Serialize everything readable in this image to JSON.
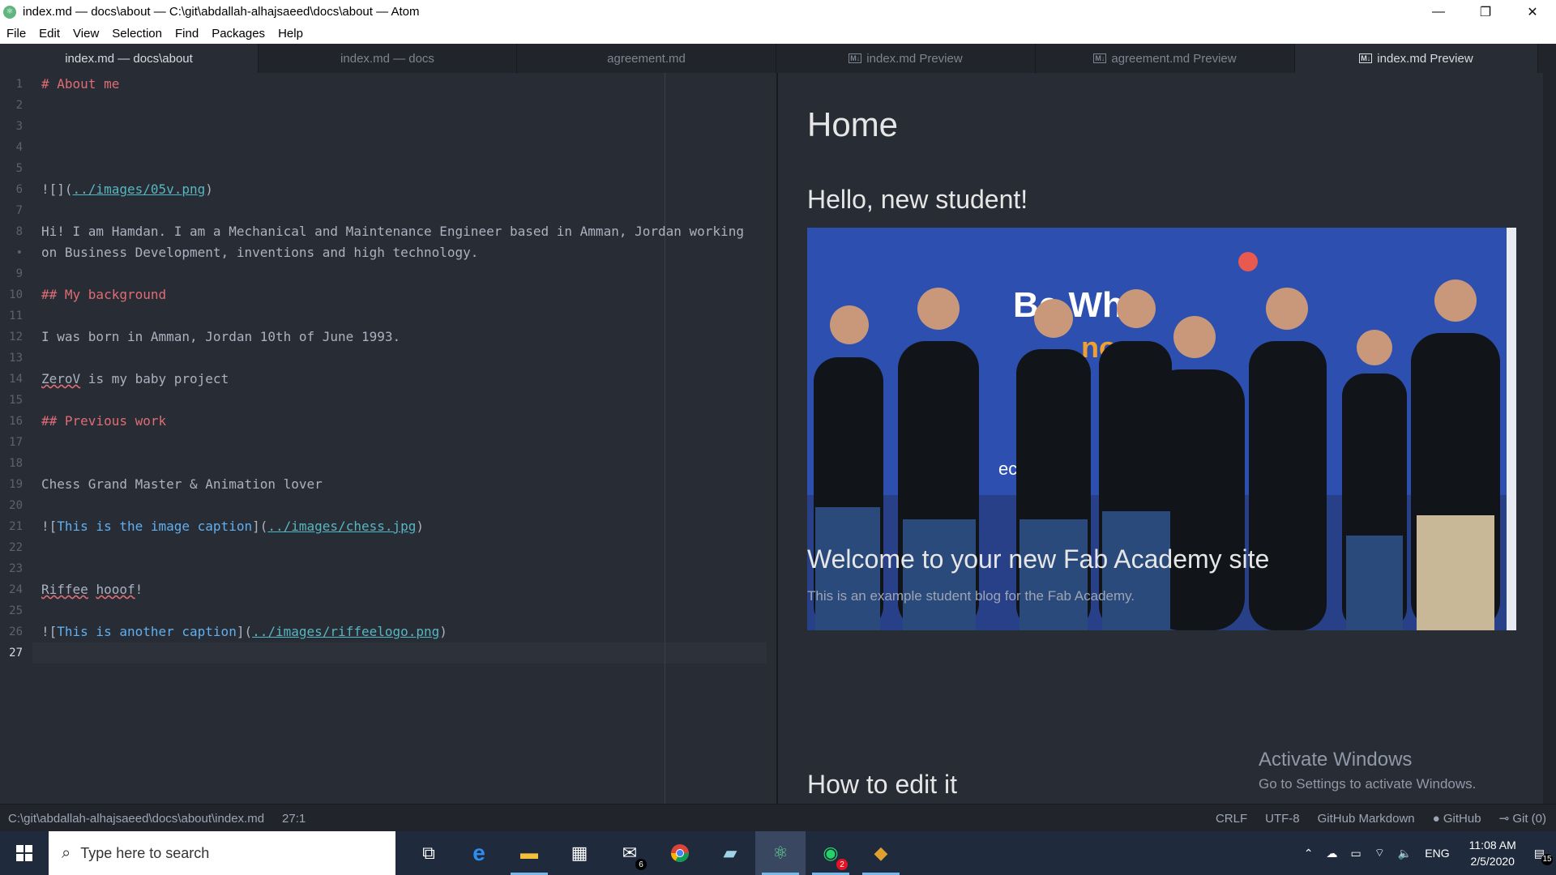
{
  "window": {
    "title": "index.md — docs\\about — C:\\git\\abdallah-alhajsaeed\\docs\\about — Atom",
    "minimize": "—",
    "maximize": "❐",
    "close": "✕"
  },
  "menu": [
    "File",
    "Edit",
    "View",
    "Selection",
    "Find",
    "Packages",
    "Help"
  ],
  "tabs": [
    {
      "label": "index.md — docs\\about",
      "md_icon": ""
    },
    {
      "label": "index.md — docs",
      "md_icon": ""
    },
    {
      "label": "agreement.md",
      "md_icon": ""
    },
    {
      "label": "index.md Preview",
      "md_icon": "M↓"
    },
    {
      "label": "agreement.md Preview",
      "md_icon": "M↓"
    },
    {
      "label": "index.md Preview",
      "md_icon": "M↓"
    }
  ],
  "editor": {
    "line_numbers": [
      "1",
      "2",
      "3",
      "4",
      "5",
      "6",
      "7",
      "8",
      "•",
      "9",
      "10",
      "11",
      "12",
      "13",
      "14",
      "15",
      "16",
      "17",
      "18",
      "19",
      "20",
      "21",
      "22",
      "23",
      "24",
      "25",
      "26",
      "27"
    ],
    "lines": {
      "l1": "# About me",
      "l6a": "![](",
      "l6b": "../images/05v.png",
      "l6c": ")",
      "l8": "Hi! I am Hamdan. I am a Mechanical and Maintenance Engineer based in Amman, Jordan working",
      "l8b": "on Business Development, inventions and high technology.",
      "l10": "## My background",
      "l12": "I was born in Amman, Jordan 10th of June 1993.",
      "l14a": "ZeroV",
      "l14b": " is my baby project",
      "l16": "## Previous work",
      "l19": "Chess Grand Master & Animation lover",
      "l21a": "![",
      "l21b": "This is the image caption",
      "l21c": "](",
      "l21d": "../images/chess.jpg",
      "l21e": ")",
      "l24a": "Riffee",
      "l24b": " ",
      "l24c": "hooof",
      "l24d": "!",
      "l26a": "![",
      "l26b": "This is another caption",
      "l26c": "](",
      "l26d": "../images/riffeelogo.png",
      "l26e": ")"
    }
  },
  "preview": {
    "h1": "Home",
    "h2_hello": "Hello, new student!",
    "h2_welcome": "Welcome to your new Fab Academy site",
    "p_example": "This is an example student blog for the Fab Academy.",
    "h2_edit": "How to edit it",
    "photo_banner_text": "Be Whe",
    "photo_banner_text2": "nova",
    "photo_banner_text3": "ec"
  },
  "watermark": {
    "line1": "Activate Windows",
    "line2": "Go to Settings to activate Windows."
  },
  "status": {
    "path": "C:\\git\\abdallah-alhajsaeed\\docs\\about\\index.md",
    "cursor": "27:1",
    "line_ending": "CRLF",
    "encoding": "UTF-8",
    "grammar": "GitHub Markdown",
    "github": "GitHub",
    "git": "Git (0)"
  },
  "taskbar": {
    "search_placeholder": "Type here to search",
    "mail_badge": "6",
    "whatsapp_badge": "2",
    "language": "ENG",
    "time": "11:08 AM",
    "date": "2/5/2020",
    "notifications": "15"
  },
  "colors": {
    "editor_bg": "#282c34",
    "heading": "#e06c75",
    "link": "#56b6c2",
    "taskbar": "#1f2a3d"
  }
}
